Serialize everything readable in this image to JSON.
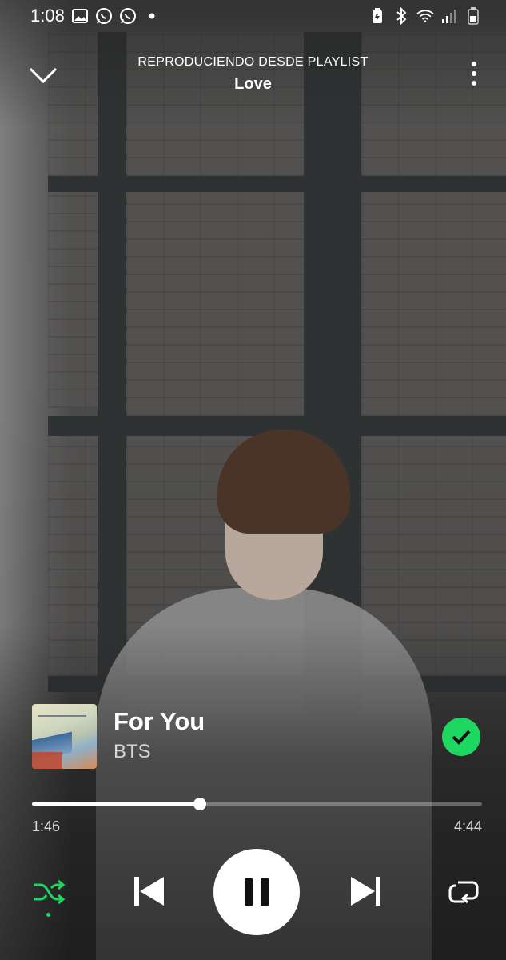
{
  "status_bar": {
    "time": "1:08",
    "left_icons": [
      "gallery-icon",
      "whatsapp-icon",
      "whatsapp-icon",
      "dot-icon"
    ],
    "right_icons": [
      "battery-saver-icon",
      "bluetooth-icon",
      "wifi-icon",
      "signal-icon",
      "battery-icon"
    ]
  },
  "header": {
    "context_label": "REPRODUCIENDO DESDE PLAYLIST",
    "playlist_name": "Love"
  },
  "track": {
    "title": "For You",
    "artist": "BTS",
    "liked": true
  },
  "playback": {
    "elapsed": "1:46",
    "total": "4:44",
    "progress_fraction": 0.373,
    "is_playing": true,
    "shuffle_on": true,
    "repeat_on": false
  },
  "colors": {
    "accent": "#1ed760",
    "text": "#ffffff"
  }
}
